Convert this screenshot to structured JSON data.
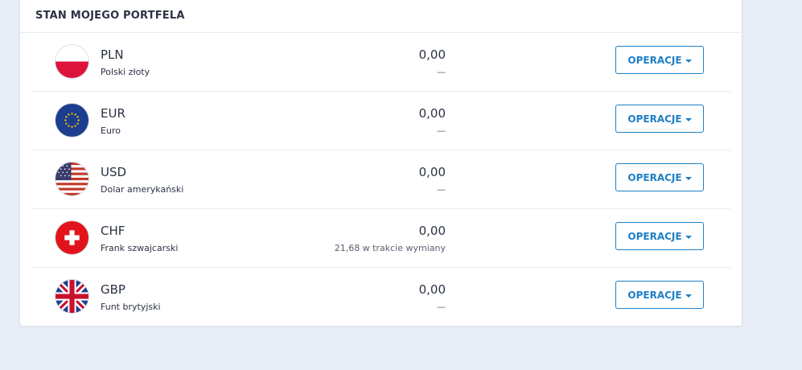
{
  "panel": {
    "title": "STAN MOJEGO PORTFELA"
  },
  "currencies": [
    {
      "code": "PLN",
      "name": "Polski złoty",
      "amount": "0,00",
      "subtext": "—",
      "button": "OPERACJE",
      "flag": "poland-flag-icon"
    },
    {
      "code": "EUR",
      "name": "Euro",
      "amount": "0,00",
      "subtext": "—",
      "button": "OPERACJE",
      "flag": "eu-flag-icon"
    },
    {
      "code": "USD",
      "name": "Dolar amerykański",
      "amount": "0,00",
      "subtext": "—",
      "button": "OPERACJE",
      "flag": "usa-flag-icon"
    },
    {
      "code": "CHF",
      "name": "Frank szwajcarski",
      "amount": "0,00",
      "subtext": "21,68 w trakcie wymiany",
      "button": "OPERACJE",
      "flag": "switzerland-flag-icon"
    },
    {
      "code": "GBP",
      "name": "Funt brytyjski",
      "amount": "0,00",
      "subtext": "—",
      "button": "OPERACJE",
      "flag": "uk-flag-icon"
    }
  ],
  "colors": {
    "accent": "#1f7fc6",
    "background": "#e9edf5",
    "text": "#2b3243"
  }
}
